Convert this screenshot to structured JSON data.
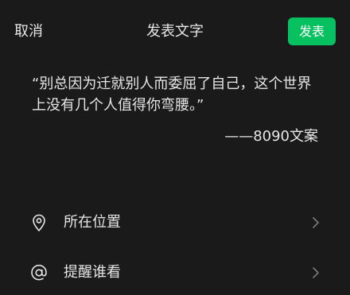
{
  "header": {
    "cancel_label": "取消",
    "title": "发表文字",
    "publish_label": "发表"
  },
  "post": {
    "text": "“别总因为迁就别人而委屈了自己，这个世界上没有几个人值得你弯腰。”",
    "attribution": "——8090文案"
  },
  "options": {
    "location_label": "所在位置",
    "location_icon": "location-pin-icon",
    "mention_label": "提醒谁看",
    "mention_icon": "at-sign-icon"
  },
  "colors": {
    "background": "#1a1a1a",
    "accent": "#07c160",
    "text": "#e6e6e6",
    "chevron": "#7a7a7a"
  }
}
